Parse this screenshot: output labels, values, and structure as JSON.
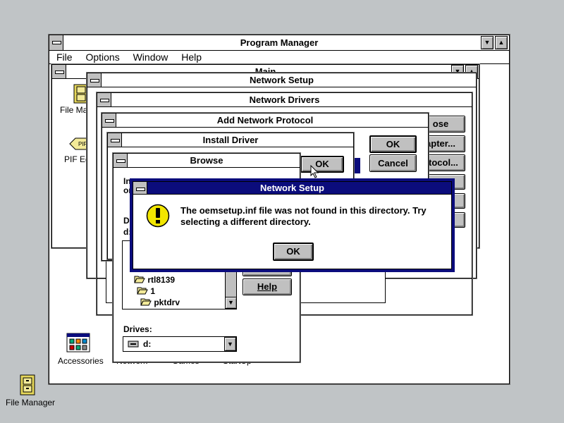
{
  "program_manager": {
    "title": "Program Manager",
    "menu": [
      "File",
      "Options",
      "Window",
      "Help"
    ]
  },
  "main_group": {
    "title": "Main",
    "icons": [
      "File Man",
      "PIF Ed"
    ]
  },
  "groups_bottom": [
    "Accessories",
    "Network",
    "Games",
    "StartUp"
  ],
  "desktop_icon": "File Manager",
  "network_setup": {
    "title": "Network Setup",
    "right_buttons": [
      "ose",
      "apter...",
      "otocol..."
    ]
  },
  "network_drivers": {
    "title": "Network Drivers"
  },
  "add_protocol": {
    "title": "Add Network Protocol",
    "ok": "OK",
    "cancel": "Cancel"
  },
  "install_driver": {
    "title": "Install Driver",
    "ok": "OK"
  },
  "browse": {
    "title": "Browse",
    "frag_i": "In",
    "frag_o": "or",
    "frag_d": "D",
    "frag_path": "d:",
    "folders": [
      "rtl8139",
      "1",
      "pktdrv"
    ],
    "help": "Help",
    "drives_label": "Drives:",
    "drive_value": "d:"
  },
  "alert": {
    "title": "Network Setup",
    "message_line1": "The oemsetup.inf file was not found in this directory. Try",
    "message_line2": "selecting a different directory.",
    "ok": "OK",
    "icon": "exclamation-icon"
  },
  "colors": {
    "desktop": "#c0c4c6",
    "active_title": "#0b0c7c",
    "button_face": "#c0c0c0",
    "warning_yellow": "#f2e600"
  }
}
